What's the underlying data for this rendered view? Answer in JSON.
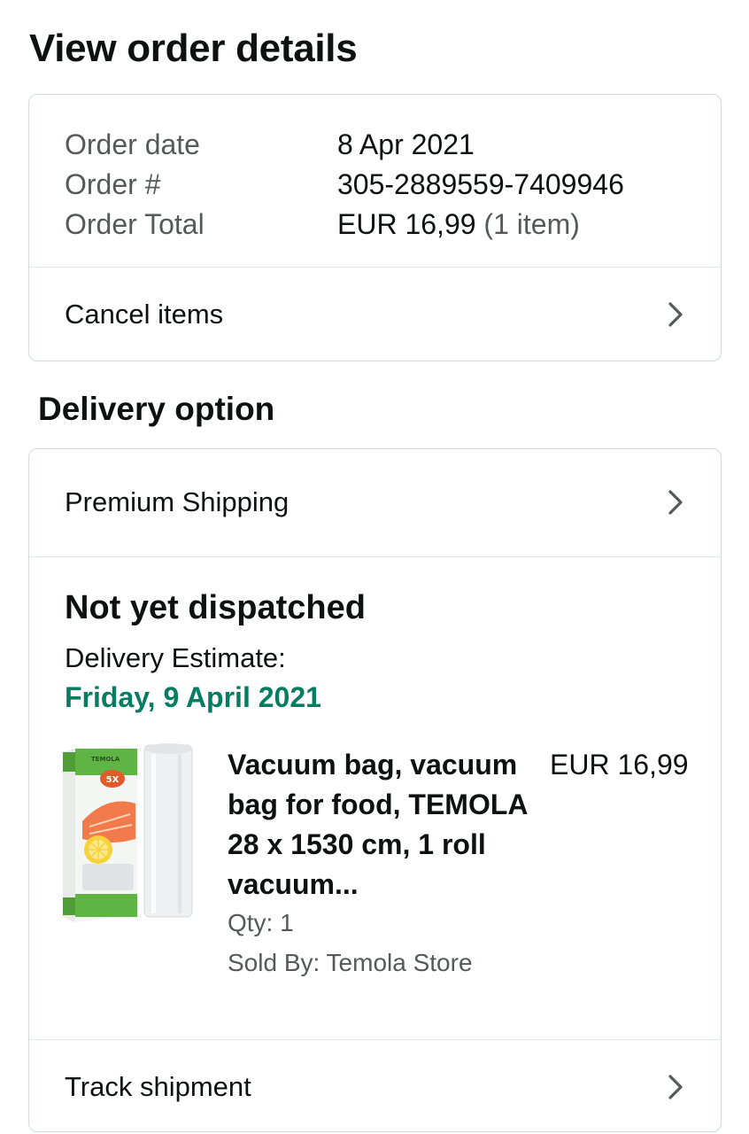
{
  "page": {
    "title": "View order details"
  },
  "summary": {
    "rows": [
      {
        "label": "Order date",
        "value": "8 Apr 2021",
        "extra": ""
      },
      {
        "label": "Order #",
        "value": "305-2889559-7409946",
        "extra": ""
      },
      {
        "label": "Order Total",
        "value": "EUR 16,99",
        "extra": "(1 item)"
      }
    ],
    "cancel_label": "Cancel items"
  },
  "delivery": {
    "section_title": "Delivery option",
    "shipping_label": "Premium Shipping",
    "status": "Not yet dispatched",
    "estimate_label": "Delivery Estimate:",
    "estimate_date": "Friday, 9 April 2021",
    "track_label": "Track shipment"
  },
  "product": {
    "title": "Vacuum bag, vacuum bag for food, TEMOLA 28 x 1530 cm, 1 roll vacuum...",
    "price": "EUR 16,99",
    "qty": "Qty: 1",
    "seller": "Sold By: Temola Store",
    "image_brand": "TEMOLA",
    "image_badge": "5X"
  },
  "colors": {
    "text": "#0f1111",
    "muted": "#565959",
    "border": "#d5d9d9",
    "success": "#067d62",
    "chevron": "#565959"
  },
  "icons": {
    "chevron": "chevron-right-icon"
  }
}
